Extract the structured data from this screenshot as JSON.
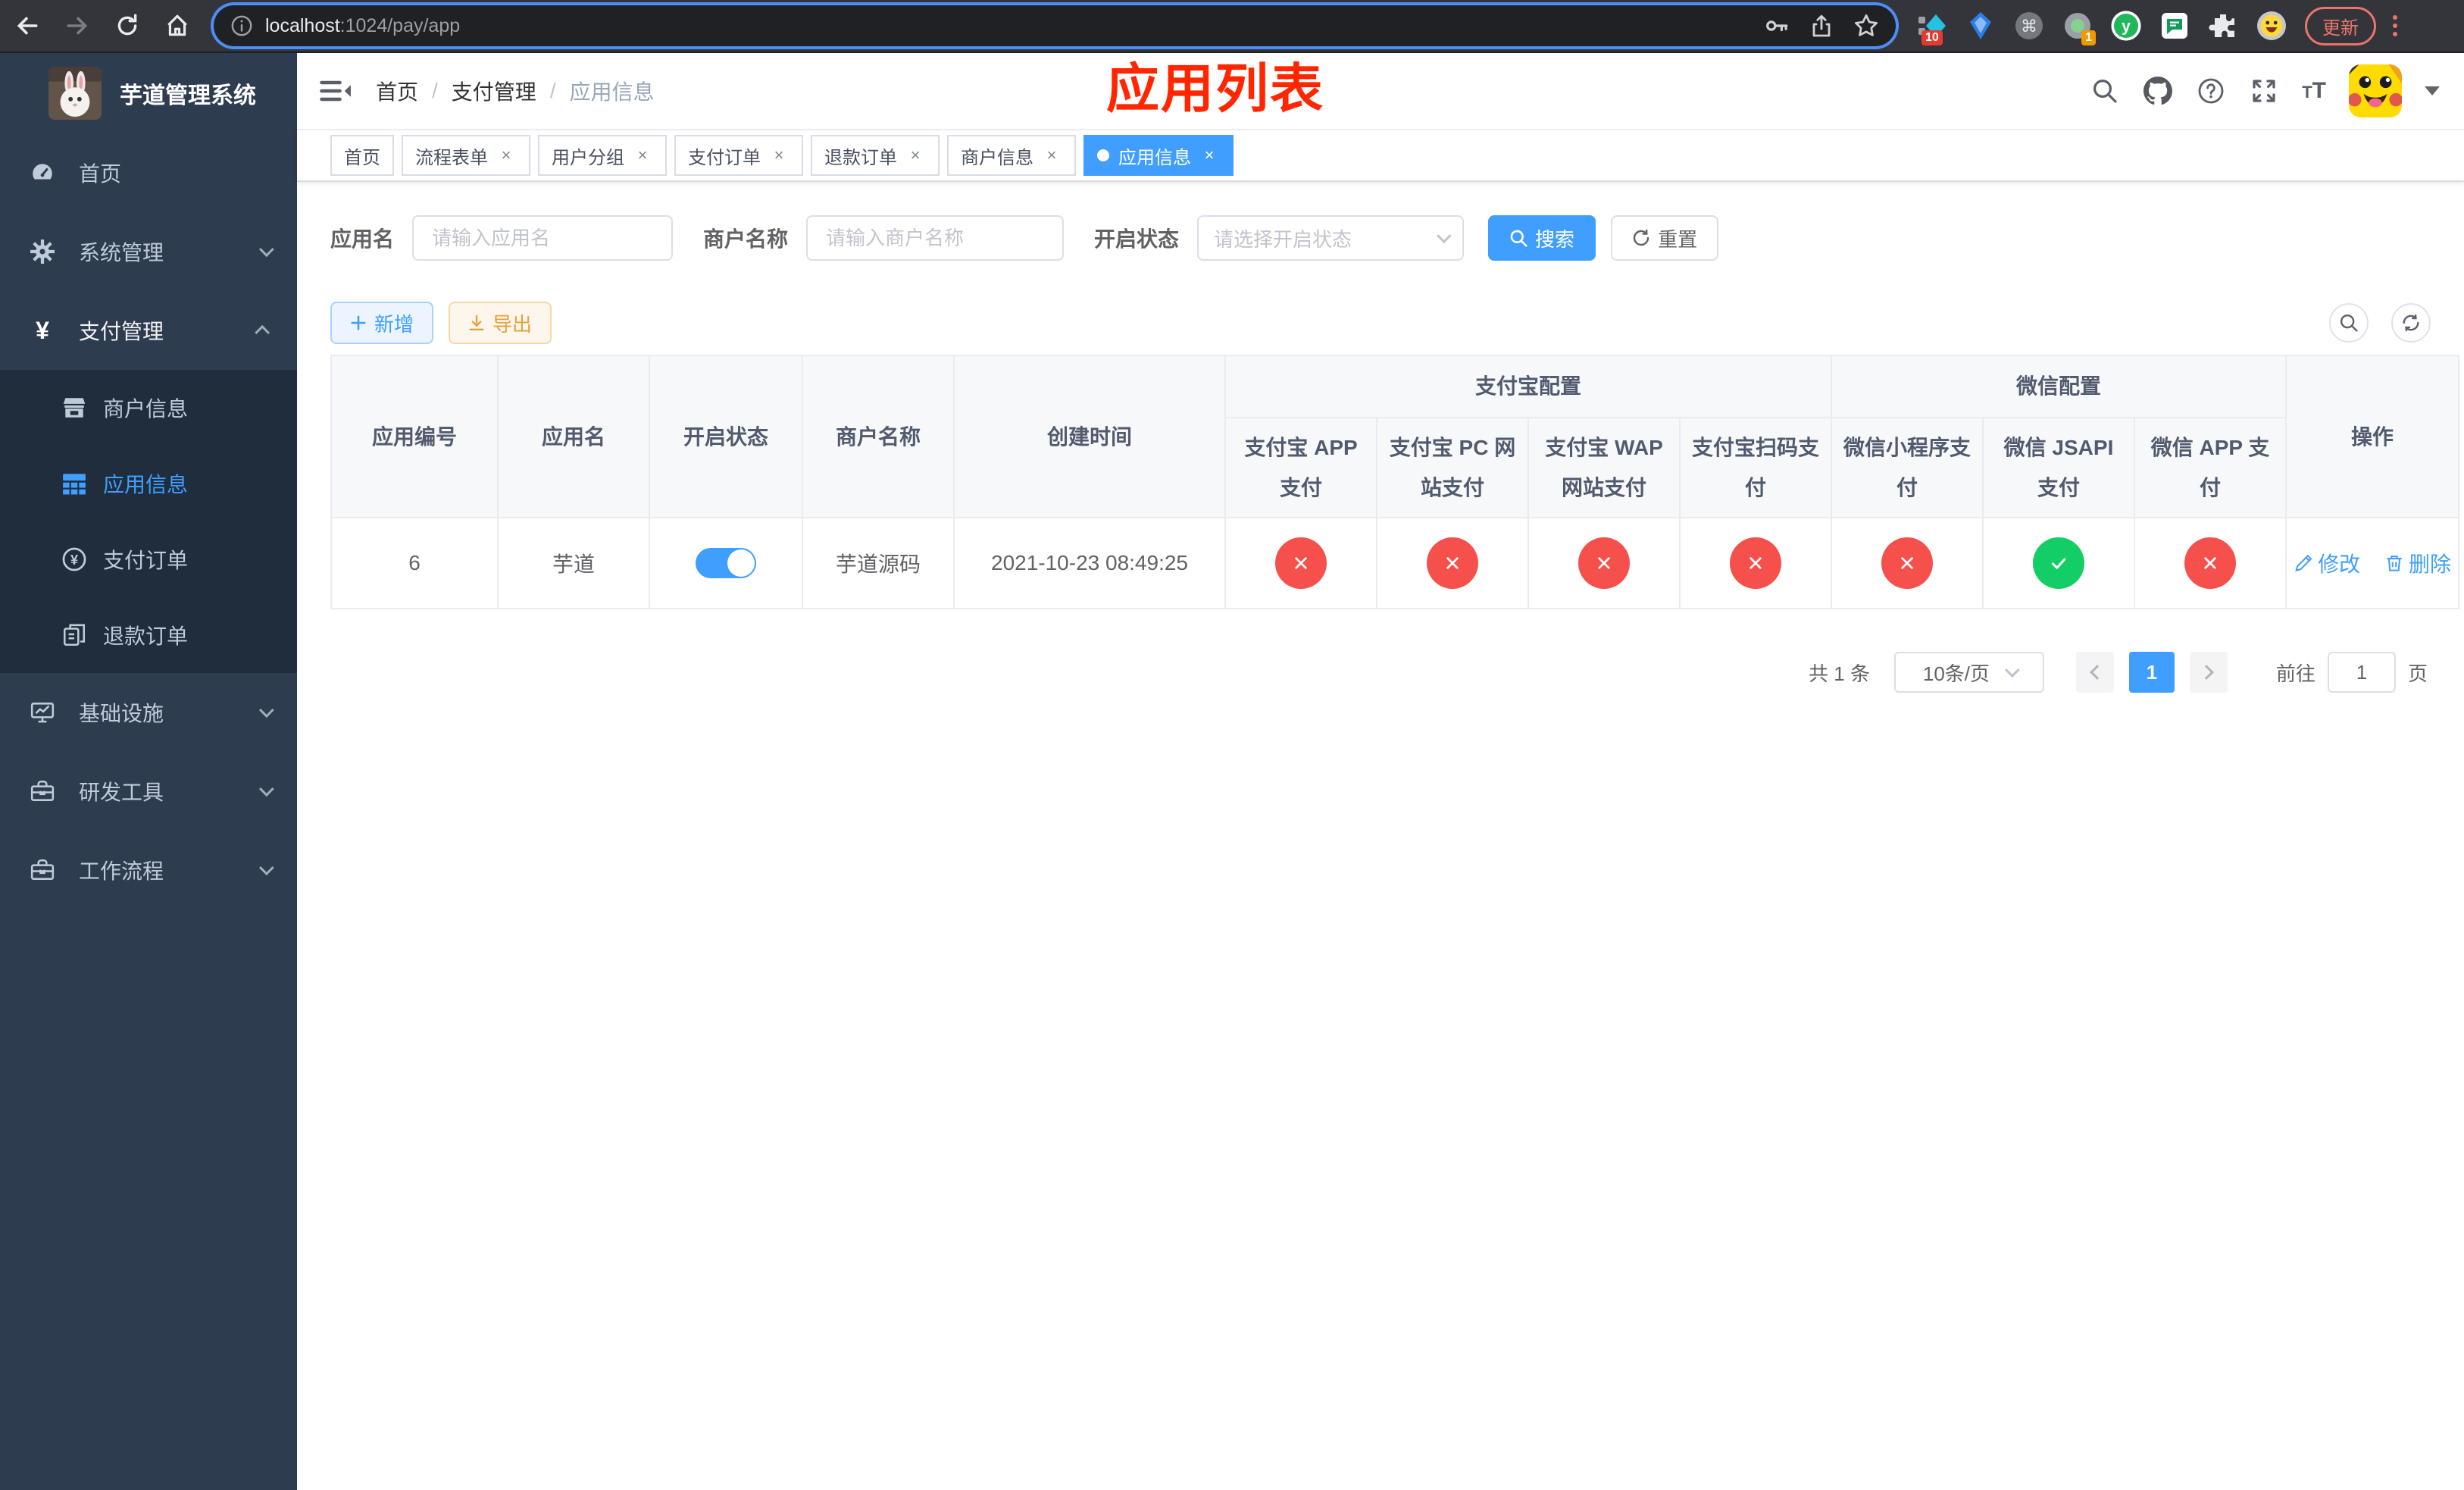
{
  "browser": {
    "url_host": "localhost",
    "url_rest": ":1024/pay/app",
    "ext_badge_1": "10",
    "ext_badge_2": "1",
    "update_label": "更新"
  },
  "sidebar": {
    "title": "芋道管理系统",
    "items": [
      {
        "label": "首页",
        "icon": "dashboard-icon"
      },
      {
        "label": "系统管理",
        "icon": "gear-icon",
        "expandable": true
      },
      {
        "label": "支付管理",
        "icon": "yen-icon",
        "expandable": true,
        "expanded": true,
        "active": true
      }
    ],
    "submenu": [
      {
        "label": "商户信息",
        "icon": "shop-icon"
      },
      {
        "label": "应用信息",
        "icon": "grid-icon",
        "active": true
      },
      {
        "label": "支付订单",
        "icon": "pay-order-icon"
      },
      {
        "label": "退款订单",
        "icon": "refund-order-icon"
      }
    ],
    "items_bottom": [
      {
        "label": "基础设施",
        "icon": "infrastructure-icon",
        "expandable": true
      },
      {
        "label": "研发工具",
        "icon": "dev-tools-icon",
        "expandable": true
      },
      {
        "label": "工作流程",
        "icon": "workflow-icon",
        "expandable": true
      }
    ]
  },
  "navbar": {
    "breadcrumb": [
      "首页",
      "支付管理",
      "应用信息"
    ],
    "annotation": "应用列表"
  },
  "tabs": {
    "items": [
      {
        "label": "首页",
        "closable": false
      },
      {
        "label": "流程表单",
        "closable": true
      },
      {
        "label": "用户分组",
        "closable": true
      },
      {
        "label": "支付订单",
        "closable": true
      },
      {
        "label": "退款订单",
        "closable": true
      },
      {
        "label": "商户信息",
        "closable": true
      },
      {
        "label": "应用信息",
        "closable": true,
        "active": true
      }
    ]
  },
  "filters": {
    "app_name_label": "应用名",
    "app_name_placeholder": "请输入应用名",
    "merchant_label": "商户名称",
    "merchant_placeholder": "请输入商户名称",
    "status_label": "开启状态",
    "status_placeholder": "请选择开启状态",
    "search_label": "搜索",
    "reset_label": "重置"
  },
  "toolbar": {
    "add_label": "新增",
    "export_label": "导出"
  },
  "table": {
    "col_app_id": "应用编号",
    "col_app_name": "应用名",
    "col_status": "开启状态",
    "col_merchant": "商户名称",
    "col_created": "创建时间",
    "group_alipay": "支付宝配置",
    "group_wechat": "微信配置",
    "col_alipay_app": "支付宝 APP 支付",
    "col_alipay_pc": "支付宝 PC 网站支付",
    "col_alipay_wap": "支付宝 WAP 网站支付",
    "col_alipay_qr": "支付宝扫码支付",
    "col_wx_mini": "微信小程序支付",
    "col_wx_jsapi": "微信 JSAPI 支付",
    "col_wx_app": "微信 APP 支付",
    "col_actions": "操作",
    "row": {
      "id": "6",
      "name": "芋道",
      "enabled": true,
      "merchant": "芋道源码",
      "created": "2021-10-23 08:49:25",
      "configs": {
        "alipay_app": "disabled",
        "alipay_pc": "disabled",
        "alipay_wap": "disabled",
        "alipay_qr": "disabled",
        "wx_mini": "disabled",
        "wx_jsapi": "enabled",
        "wx_app": "disabled"
      },
      "edit_label": "修改",
      "delete_label": "删除"
    }
  },
  "pagination": {
    "total": "共 1 条",
    "page_size": "10条/页",
    "current_page": "1",
    "goto_label": "前往",
    "goto_value": "1",
    "page_label": "页"
  },
  "colors": {
    "accent": "#409eff",
    "success_circle": "#13ce66",
    "danger_circle": "#f5504c",
    "warning": "#e6a23c",
    "annotation_red": "#ff2600",
    "sidebar_bg": "#2e3c50",
    "submenu_bg": "#1f2d3d"
  }
}
